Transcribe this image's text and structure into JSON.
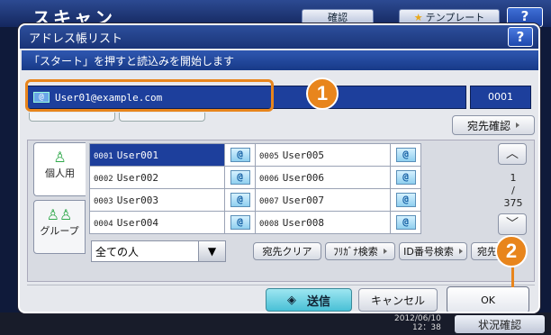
{
  "background": {
    "title": "スキャン",
    "confirm_button": "確認",
    "template_button": "テンプレート",
    "help_label": "?",
    "clock_date": "2012/06/10",
    "clock_time": "12：38",
    "status_button": "状況確認"
  },
  "dialog": {
    "title": "アドレス帳リスト",
    "help_label": "?",
    "message": "「スタート」を押すと読込みを開始します",
    "address_value": "User01@example.com",
    "address_icon": "@",
    "address_count": "0001",
    "destination_confirm": "宛先確認",
    "tabs": [
      {
        "label": "個人用",
        "icon": "person-icon"
      },
      {
        "label": "グループ",
        "icon": "group-icon"
      }
    ],
    "entries_left": [
      {
        "num": "0001",
        "name": "User001",
        "selected": true
      },
      {
        "num": "0002",
        "name": "User002",
        "selected": false
      },
      {
        "num": "0003",
        "name": "User003",
        "selected": false
      },
      {
        "num": "0004",
        "name": "User004",
        "selected": false
      }
    ],
    "entries_right": [
      {
        "num": "0005",
        "name": "User005"
      },
      {
        "num": "0006",
        "name": "User006"
      },
      {
        "num": "0007",
        "name": "User007"
      },
      {
        "num": "0008",
        "name": "User008"
      }
    ],
    "at_symbol": "@",
    "page_current": "1",
    "page_total": "375",
    "page_separator": "/",
    "filter_value": "全ての人",
    "clear_button": "宛先クリア",
    "furigana_search": "ﾌﾘｶﾞﾅ検索",
    "id_search": "ID番号検索",
    "partial_button": "宛先",
    "send_button": "送信",
    "cancel_button": "キャンセル",
    "ok_button": "OK",
    "callout_1": "1",
    "callout_2": "2"
  }
}
